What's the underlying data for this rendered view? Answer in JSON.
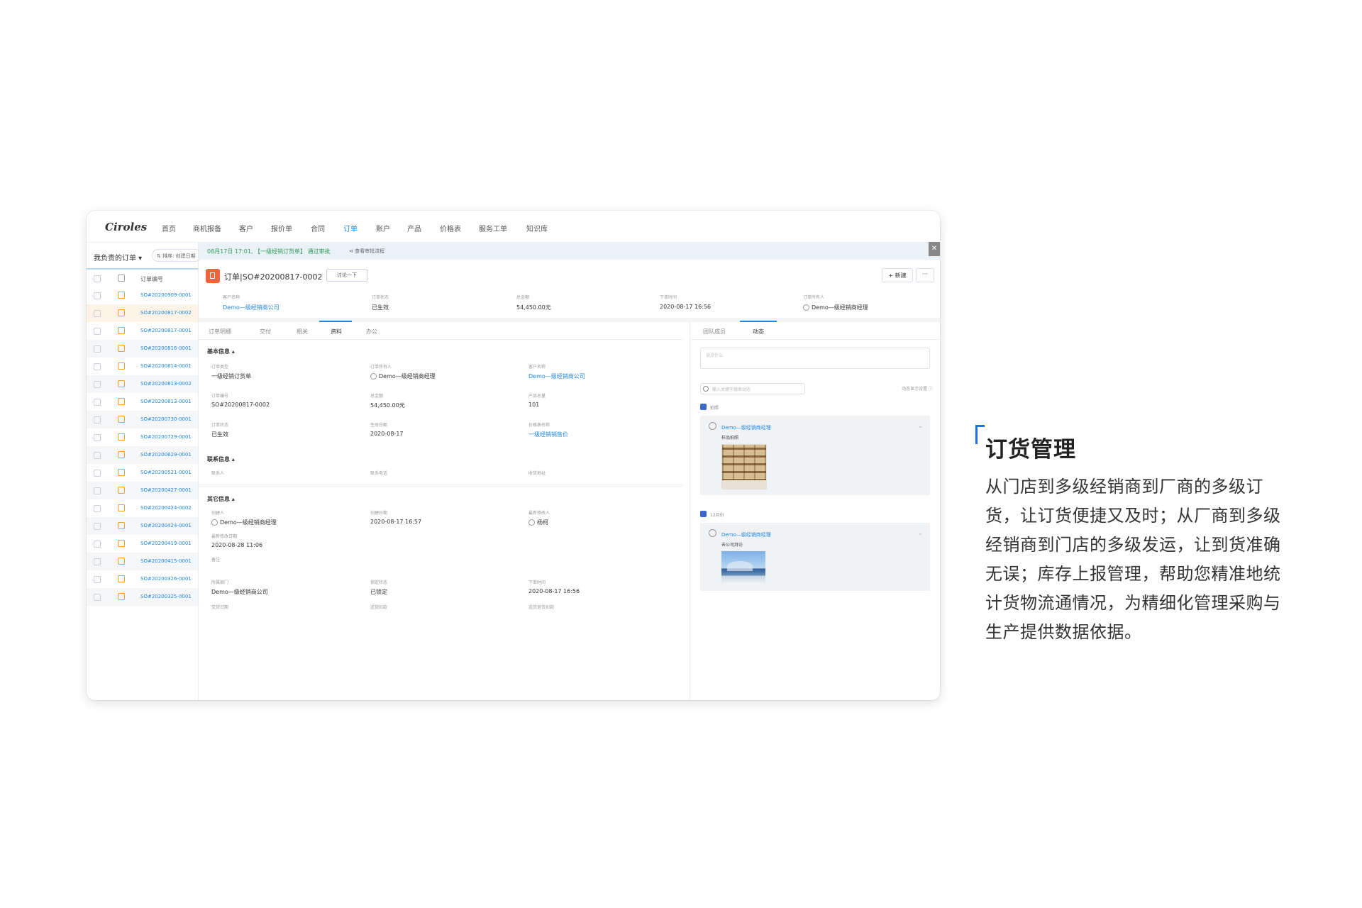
{
  "app": {
    "logo": "Ciroles",
    "nav": [
      "首页",
      "商机报备",
      "客户",
      "报价单",
      "合同",
      "订单",
      "账户",
      "产品",
      "价格表",
      "服务工单",
      "知识库"
    ],
    "nav_active": "订单"
  },
  "sidebar": {
    "header": "我负责的订单 ▾",
    "sort_label": "⇅ 排序: 创建日期",
    "column_header": "订单编号",
    "orders": [
      "SO#20200909-0001",
      "SO#20200817-0002",
      "SO#20200817-0001",
      "SO#20200816-0001",
      "SO#20200814-0001",
      "SO#20200813-0002",
      "SO#20200813-0001",
      "SO#20200730-0001",
      "SO#20200729-0001",
      "SO#20200629-0001",
      "SO#20200521-0001",
      "SO#20200427-0001",
      "SO#20200424-0002",
      "SO#20200424-0001",
      "SO#20200419-0001",
      "SO#20200415-0001",
      "SO#20200326-0001",
      "SO#20200325-0001"
    ],
    "selected_index": 1
  },
  "banner": {
    "text": "08月17日 17:01, 【一级经销订货单】 通过审批",
    "link": "⊲ 查看审批流程",
    "close": "✕"
  },
  "order": {
    "title": "订单|SO#20200817-0002",
    "discuss": "讨论一下",
    "new_button": "+ 新建",
    "more_button": "···",
    "summary": [
      {
        "label": "客户名称",
        "value": "Demo—级经销商公司",
        "link": true
      },
      {
        "label": "订单状态",
        "value": "已生效"
      },
      {
        "label": "总金额",
        "value": "54,450.00元"
      },
      {
        "label": "下单时间",
        "value": "2020-08-17 16:56"
      },
      {
        "label": "订单所有人",
        "value": "Demo—级经销商经理",
        "avatar": true
      }
    ]
  },
  "tabs": [
    "订单明细",
    "交付",
    "相关",
    "资料",
    "办公"
  ],
  "active_tab": "资料",
  "detail": {
    "basic_title": "基本信息 ▴",
    "basic_fields": [
      {
        "label": "订单类型",
        "value": "一级经销订货单"
      },
      {
        "label": "订单所有人",
        "value": "Demo—级经销商经理",
        "avatar": true
      },
      {
        "label": "客户名称",
        "value": "Demo—级经销商公司",
        "link": true
      },
      {
        "label": "订单编号",
        "value": "SO#20200817-0002"
      },
      {
        "label": "总金额",
        "value": "54,450.00元"
      },
      {
        "label": "产品总量",
        "value": "101"
      },
      {
        "label": "订单状态",
        "value": "已生效"
      },
      {
        "label": "生效日期",
        "value": "2020-08-17"
      },
      {
        "label": "价格表名称",
        "value": "一级经销销售价",
        "link": true
      }
    ],
    "contact_title": "联系信息 ▴",
    "contact_fields": [
      "联系人",
      "联系电话",
      "收货地址"
    ],
    "other_title": "其它信息 ▴",
    "other_fields": [
      {
        "label": "创建人",
        "value": "Demo—级经销商经理",
        "avatar": true
      },
      {
        "label": "创建日期",
        "value": "2020-08-17 16:57"
      },
      {
        "label": "最新修改人",
        "value": "杨柯",
        "avatar": true
      },
      {
        "label": "最新修改日期",
        "value": "2020-08-28 11:06"
      },
      {
        "label": "备注",
        "value": ""
      },
      {
        "label": "所属部门",
        "value": "Demo—级经销商公司"
      },
      {
        "label": "锁定状态",
        "value": "已锁定"
      },
      {
        "label": "下单时间",
        "value": "2020-08-17 16:56"
      },
      {
        "label": "交货日期",
        "value": ""
      },
      {
        "label": "送货扣款",
        "value": ""
      },
      {
        "label": "送货退货扣款",
        "value": ""
      }
    ]
  },
  "right": {
    "tabs": [
      "团队成员",
      "动态"
    ],
    "active_tab": "动态",
    "post_placeholder": "说点什么",
    "search_placeholder": "输入关键字搜索动态",
    "settings": "动态显示设置 ⓘ",
    "feed": [
      {
        "tag": "拍照",
        "author": "Demo—级经销商经理",
        "sub": "样品拍照",
        "image": "shelf"
      },
      {
        "tag": "12月份",
        "author": "Demo—级经销商经理",
        "sub": "去公司拜访",
        "image": "building"
      }
    ],
    "chevron": "⌄"
  },
  "feature": {
    "title": "订货管理",
    "description": "从门店到多级经销商到厂商的多级订货，让订货便捷又及时；从厂商到多级经销商到门店的多级发运，让到货准确无误；库存上报管理，帮助您精准地统计货物流通情况，为精细化管理采购与生产提供数据依据。"
  }
}
